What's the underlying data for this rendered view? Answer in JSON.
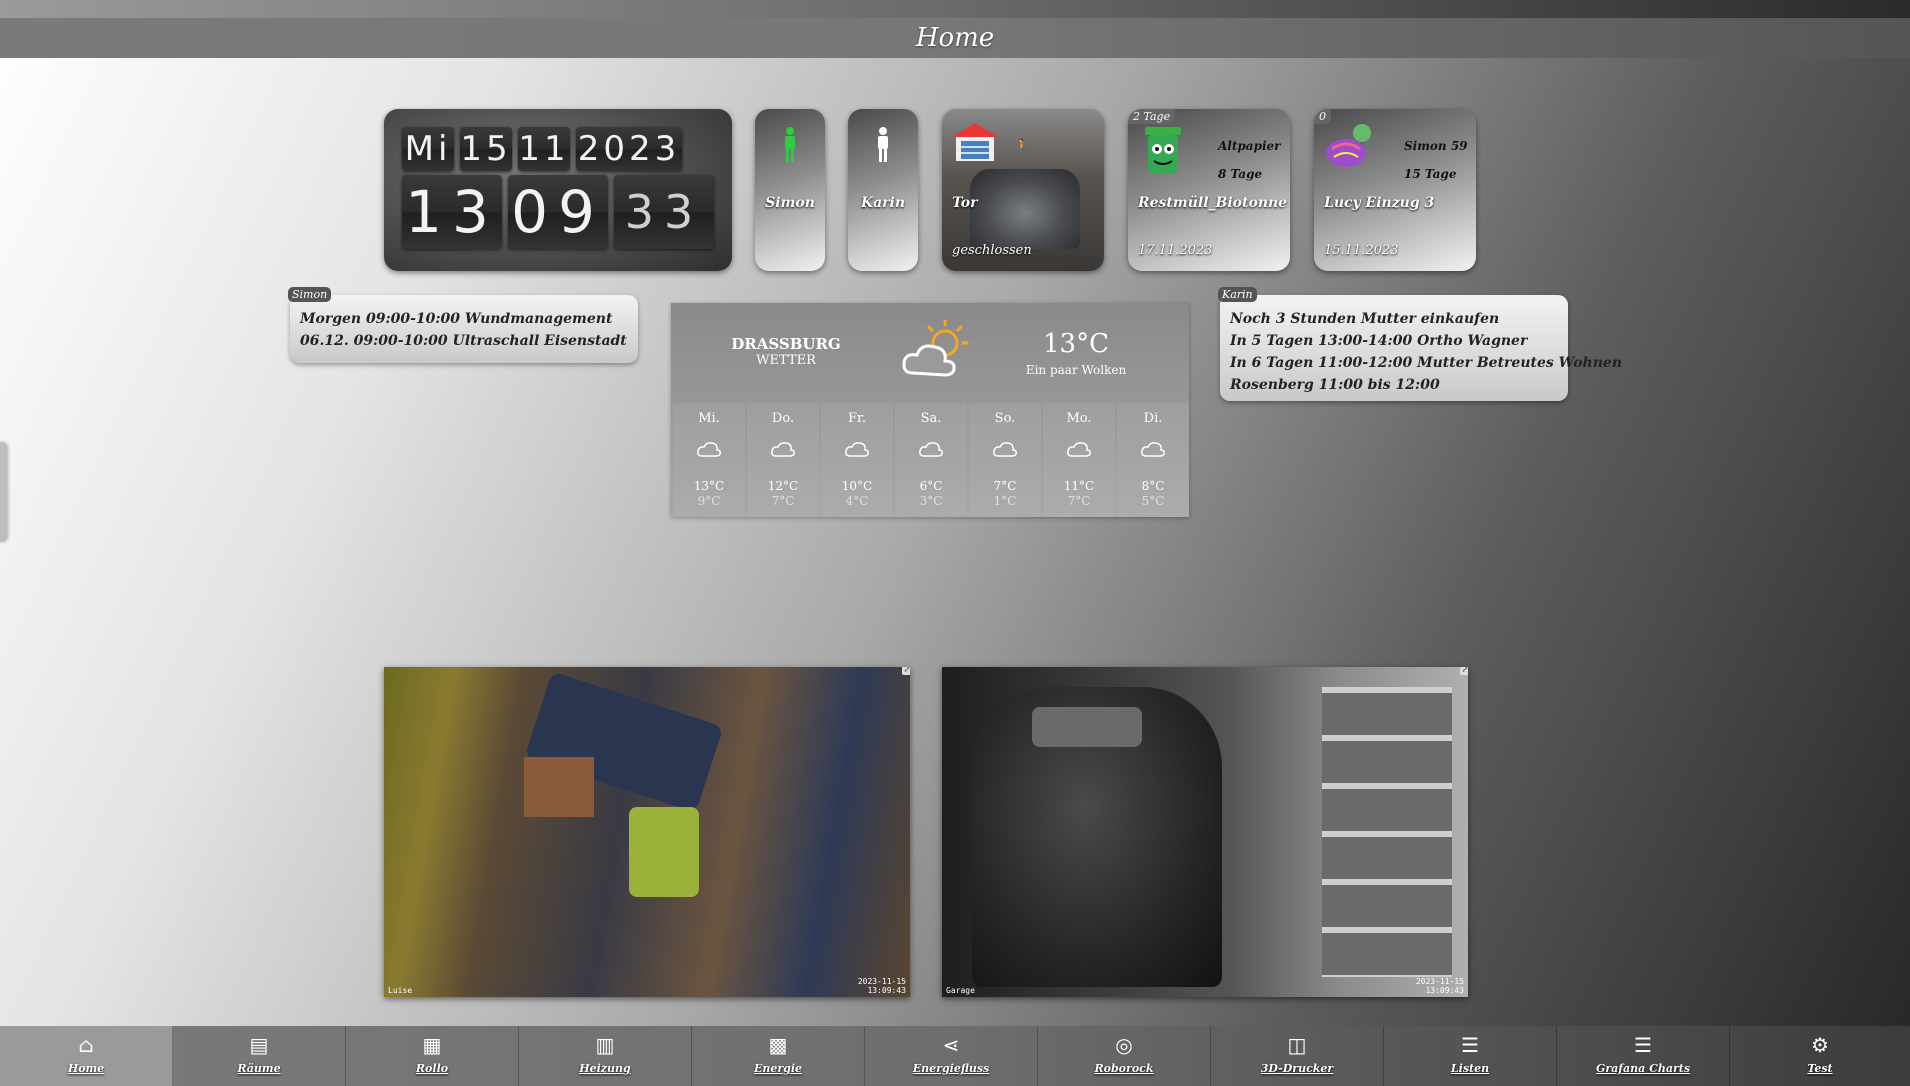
{
  "page": {
    "title": "Home"
  },
  "clock": {
    "weekday": "Mi",
    "day": "15",
    "month": "11",
    "year": "2023",
    "hour": "13",
    "minute": "09",
    "second": "33"
  },
  "persons": [
    {
      "name": "Simon"
    },
    {
      "name": "Karin"
    }
  ],
  "garage": {
    "name": "Tor",
    "status": "geschlossen"
  },
  "waste": {
    "badge": "2 Tage",
    "name": "Restmüll_Biotonne",
    "date": "17.11.2023",
    "next_label": "Altpapier",
    "next_days": "8 Tage"
  },
  "birthday": {
    "badge": "0",
    "name": "Lucy Einzug 3",
    "date": "15.11.2023",
    "next_label": "Simon 59",
    "next_days": "15 Tage"
  },
  "calendar_simon": {
    "owner": "Simon",
    "entries": [
      "Morgen 09:00-10:00 Wundmanagement",
      "06.12. 09:00-10:00 Ultraschall Eisenstadt"
    ]
  },
  "calendar_karin": {
    "owner": "Karin",
    "entries": [
      "Noch 3 Stunden Mutter einkaufen",
      "In 5 Tagen 13:00-14:00 Ortho Wagner",
      "In 6 Tagen 11:00-12:00 Mutter Betreutes Wohnen",
      "Rosenberg 11:00 bis 12:00"
    ]
  },
  "weather": {
    "location": "DRASSBURG",
    "subtitle": "WETTER",
    "temp": "13°C",
    "desc": "Ein paar Wolken",
    "forecast": [
      {
        "day": "Mi.",
        "hi": "13°C",
        "lo": "9°C"
      },
      {
        "day": "Do.",
        "hi": "12°C",
        "lo": "7°C"
      },
      {
        "day": "Fr.",
        "hi": "10°C",
        "lo": "4°C"
      },
      {
        "day": "Sa.",
        "hi": "6°C",
        "lo": "3°C"
      },
      {
        "day": "So.",
        "hi": "7°C",
        "lo": "1°C"
      },
      {
        "day": "Mo.",
        "hi": "11°C",
        "lo": "7°C"
      },
      {
        "day": "Di.",
        "hi": "8°C",
        "lo": "5°C"
      }
    ]
  },
  "cameras": [
    {
      "label": "Luise",
      "date": "2023-11-15",
      "time": "13:09:43"
    },
    {
      "label": "Garage",
      "date": "2023-11-15",
      "time": "13:09:43"
    }
  ],
  "nav": [
    {
      "label": "Home",
      "icon": "⌂"
    },
    {
      "label": "Räume",
      "icon": "▤"
    },
    {
      "label": "Rollo",
      "icon": "▦"
    },
    {
      "label": "Heizung",
      "icon": "▥"
    },
    {
      "label": "Energie",
      "icon": "▩"
    },
    {
      "label": "Energiefluss",
      "icon": "⋖"
    },
    {
      "label": "Roborock",
      "icon": "◎"
    },
    {
      "label": "3D-Drucker",
      "icon": "◫"
    },
    {
      "label": "Listen",
      "icon": "☰"
    },
    {
      "label": "Grafana Charts",
      "icon": "☰"
    },
    {
      "label": "Test",
      "icon": "⚙"
    }
  ]
}
